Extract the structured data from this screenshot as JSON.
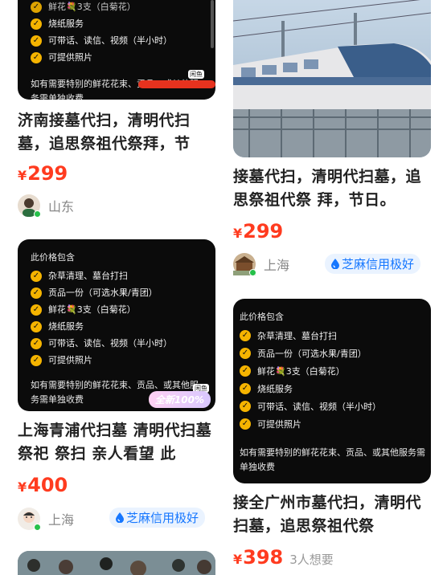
{
  "left": {
    "card1": {
      "items": [
        "烧纸服务",
        "可带话、读信、视频（半小时）",
        "可提供照片"
      ],
      "note": "如有需要特别的鲜花花束、贡品、或其他服务需单独收费",
      "tag": "闲鱼",
      "title": "济南接墓代扫，清明代扫墓，追思祭祖代祭拜，节",
      "price": "299",
      "yen": "¥",
      "location": "山东"
    },
    "card2": {
      "header": "此价格包含",
      "items": [
        "杂草清理、墓台打扫",
        "贡品一份（可选水果/青团）",
        "鲜花💐3支（白菊花）",
        "烧纸服务",
        "可带话、读信、视频（半小时）",
        "可提供照片"
      ],
      "note": "如有需要特别的鲜花花束、贡品、或其他服务需单独收费",
      "tag": "闲鱼",
      "new_badge": "全新100%",
      "title": "上海青浦代扫墓 清明代扫墓 祭祀 祭扫 亲人看望 此",
      "price": "400",
      "yen": "¥",
      "location": "上海",
      "credit": "芝麻信用极好"
    }
  },
  "right": {
    "card1": {
      "title": "接墓代扫，清明代扫墓，追思祭祖代祭 拜，节日。",
      "price": "299",
      "yen": "¥",
      "location": "上海",
      "credit": "芝麻信用极好"
    },
    "card2": {
      "header": "此价格包含",
      "items": [
        "杂草清理、墓台打扫",
        "贡品一份（可选水果/青团）",
        "鲜花💐3支（白菊花）",
        "烧纸服务",
        "可带话、读信、视频（半小时）",
        "可提供照片"
      ],
      "note": "如有需要特别的鲜花花束、贡品、或其他服务需单独收费",
      "title": "接全广州市墓代扫，清明代扫墓，追思祭祖代祭",
      "price": "398",
      "yen": "¥",
      "want": "3人想要"
    }
  },
  "colors": {
    "price": "#ff3b1f",
    "credit": "#1677ff",
    "check": "#f5b400"
  }
}
